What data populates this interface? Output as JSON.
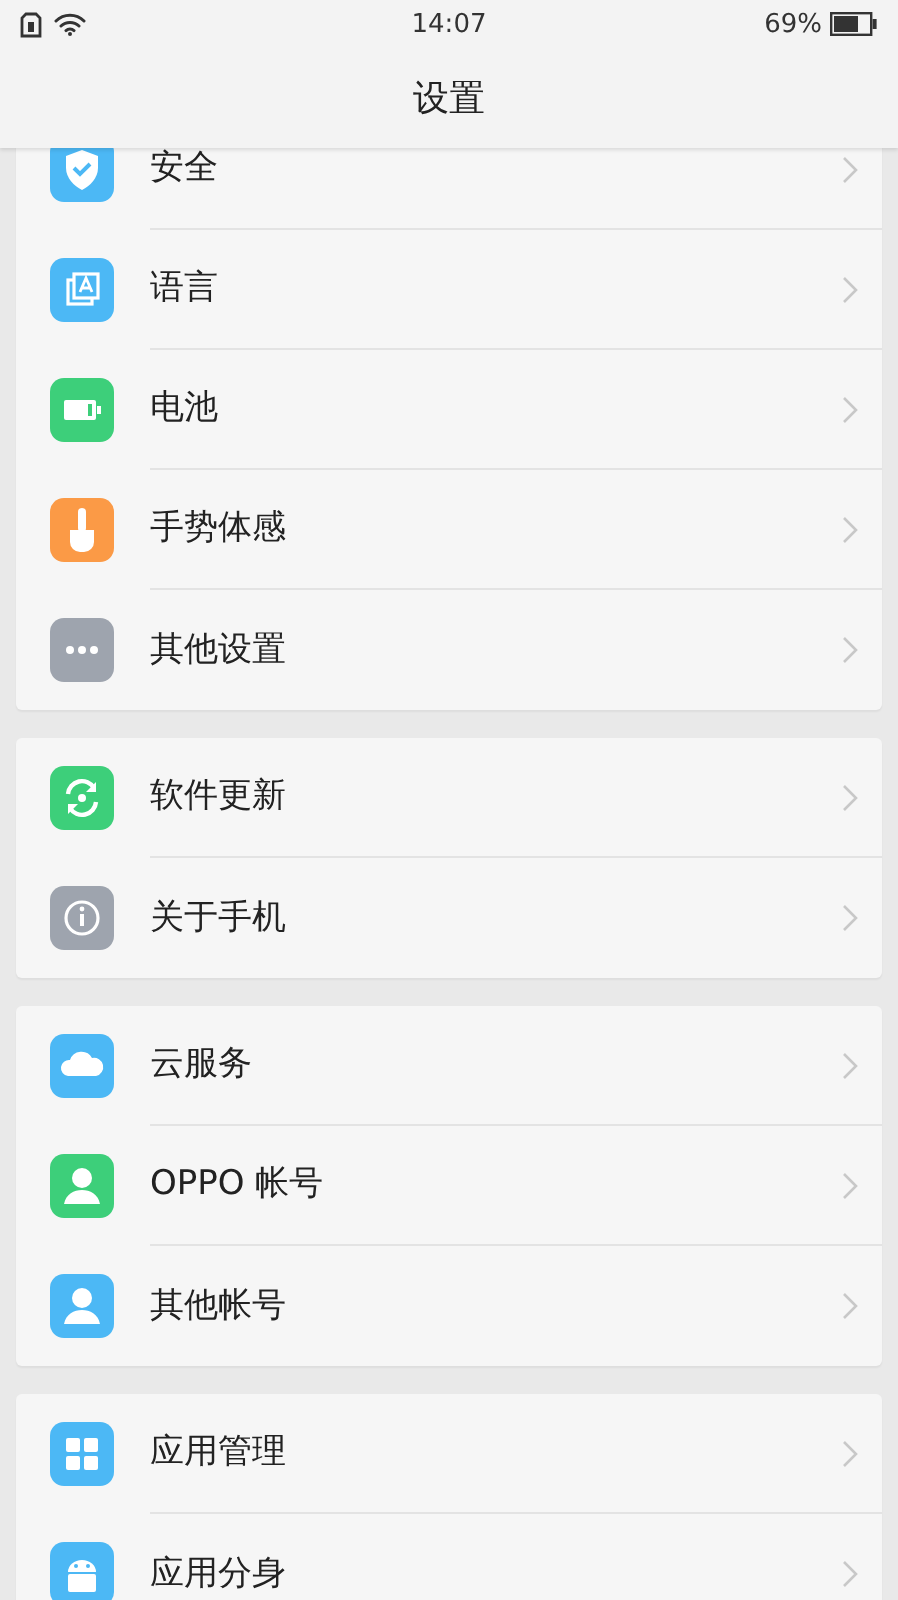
{
  "status_bar": {
    "time": "14:07",
    "battery_percent": "69%"
  },
  "title": "设置",
  "groups": [
    {
      "items": [
        {
          "label": "安全"
        },
        {
          "label": "语言"
        },
        {
          "label": "电池"
        },
        {
          "label": "手势体感"
        },
        {
          "label": "其他设置"
        }
      ]
    },
    {
      "items": [
        {
          "label": "软件更新"
        },
        {
          "label": "关于手机"
        }
      ]
    },
    {
      "items": [
        {
          "label": "云服务"
        },
        {
          "label": "OPPO 帐号"
        },
        {
          "label": "其他帐号"
        }
      ]
    },
    {
      "items": [
        {
          "label": "应用管理"
        },
        {
          "label": "应用分身"
        }
      ]
    }
  ]
}
